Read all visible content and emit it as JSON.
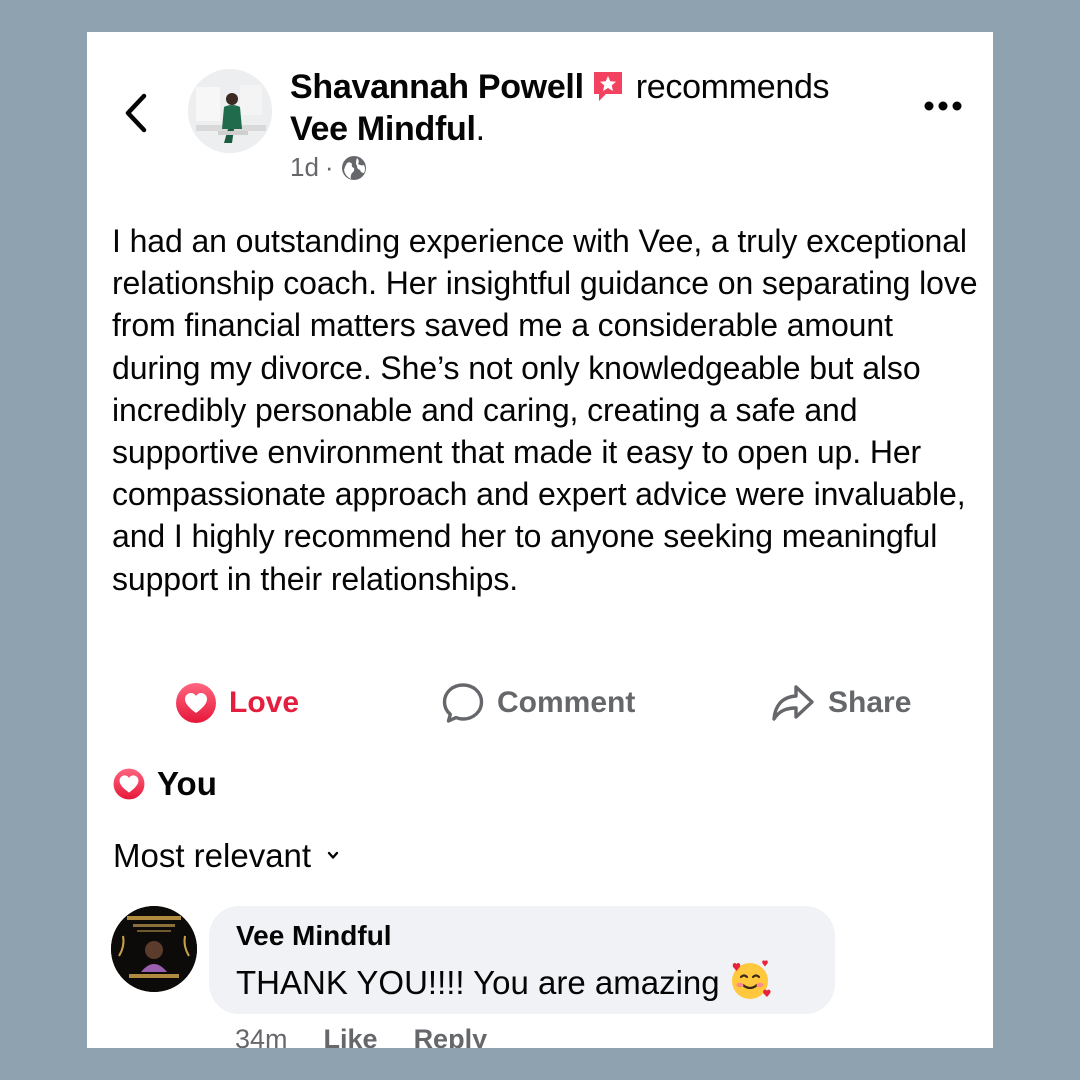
{
  "post": {
    "author": "Shavannah Powell",
    "action": "recommends",
    "page": "Vee Mindful",
    "page_suffix": ".",
    "time": "1d",
    "separator": "·",
    "privacy_icon": "globe-icon",
    "text": "I had an outstanding experience with Vee, a truly exceptional relationship coach. Her insightful guidance on separating love from financial matters saved me a considerable amount during my divorce. She’s not only knowledgeable but also incredibly personable and caring, creating a safe and supportive environment that made it easy to open up. Her compassionate approach and expert advice were invaluable, and I highly recommend her to anyone seeking meaningful support in their relationships."
  },
  "actions": {
    "love_label": "Love",
    "comment_label": "Comment",
    "share_label": "Share"
  },
  "reactions": {
    "summary": "You"
  },
  "comments_section": {
    "sort_label": "Most relevant",
    "comments": [
      {
        "author": "Vee Mindful",
        "text": "THANK YOU!!!! You are amazing",
        "emoji": "smiling-face-with-hearts",
        "time": "34m",
        "like_label": "Like",
        "reply_label": "Reply"
      }
    ]
  },
  "colors": {
    "background": "#8fa2b0",
    "love_red": "#e41e3f",
    "secondary_text": "#65676b",
    "bubble": "#f0f2f5"
  }
}
